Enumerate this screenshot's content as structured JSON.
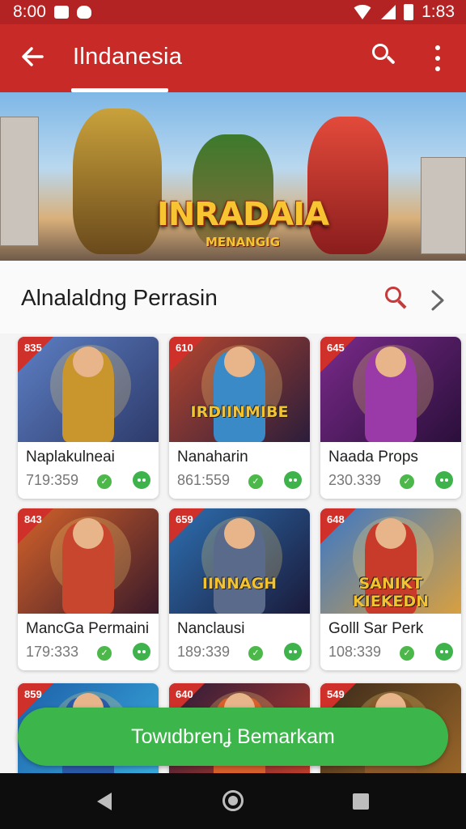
{
  "status_bar": {
    "time": "8:00",
    "battery_time": "1:83"
  },
  "app_bar": {
    "title": "Ilndanesia"
  },
  "banner": {
    "title": "INRADAIA",
    "subtitle": "MENANGIG"
  },
  "section": {
    "title": "Alnalaldng Perrasin"
  },
  "games": [
    {
      "rank": "835",
      "name": "Naplakulneai",
      "count": "719:359",
      "caption": ""
    },
    {
      "rank": "610",
      "name": "Nanaharin",
      "count": "861:559",
      "caption": "IRDIINMIBE"
    },
    {
      "rank": "645",
      "name": "Naada Props",
      "count": "230.339",
      "caption": ""
    },
    {
      "rank": "843",
      "name": "MancGa Permaini",
      "count": "179:333",
      "caption": ""
    },
    {
      "rank": "659",
      "name": "Nanclausi",
      "count": "189:339",
      "caption": "IINNAGH"
    },
    {
      "rank": "648",
      "name": "Golll Sar Perk",
      "count": "108:339",
      "caption": "SANIKT KIEKEDN"
    },
    {
      "rank": "859",
      "name": "",
      "count": "",
      "caption": ""
    },
    {
      "rank": "640",
      "name": "",
      "count": "",
      "caption": ""
    },
    {
      "rank": "549",
      "name": "",
      "count": "",
      "caption": ""
    }
  ],
  "cta": {
    "label": "Towιdbrenʝ Bemarkam"
  },
  "colors": {
    "primary": "#c72a27",
    "accent_green": "#3cb64a",
    "rank_ribbon": "#d0302a"
  },
  "icons": {
    "back": "arrow-left-icon",
    "search": "search-icon",
    "more": "more-vert-icon",
    "chevron": "chevron-right-icon"
  }
}
